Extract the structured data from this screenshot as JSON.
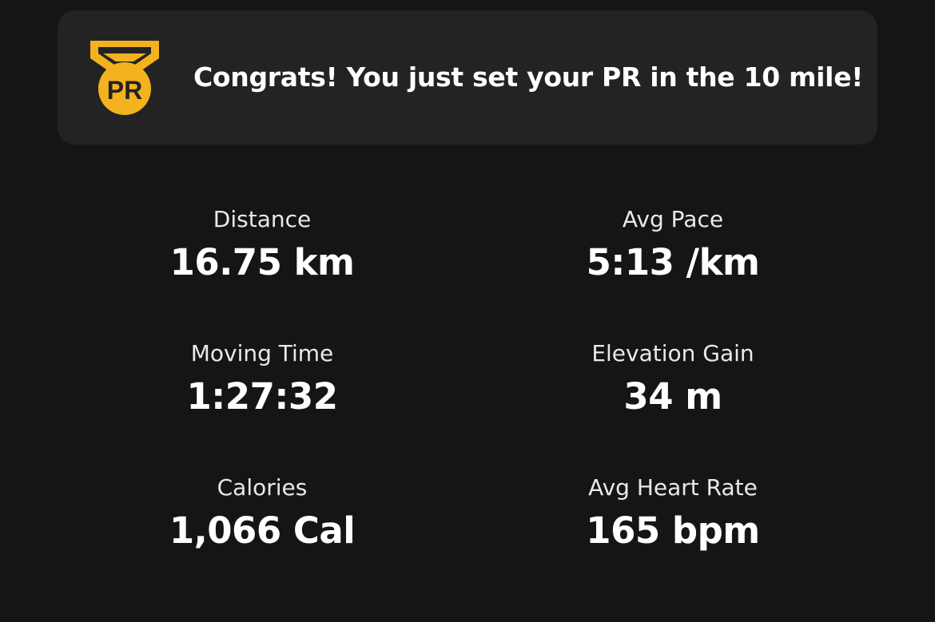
{
  "banner": {
    "badge_text": "PR",
    "message": "Congrats! You just set your PR in the 10 mile!"
  },
  "stats": [
    {
      "label": "Distance",
      "value": "16.75 km"
    },
    {
      "label": "Avg Pace",
      "value": "5:13 /km"
    },
    {
      "label": "Moving Time",
      "value": "1:27:32"
    },
    {
      "label": "Elevation Gain",
      "value": "34 m"
    },
    {
      "label": "Calories",
      "value": "1,066 Cal"
    },
    {
      "label": "Avg Heart Rate",
      "value": "165 bpm"
    }
  ],
  "colors": {
    "background": "#151515",
    "banner_background": "#232323",
    "badge_gold": "#F5B21F",
    "badge_dark": "#232323"
  }
}
